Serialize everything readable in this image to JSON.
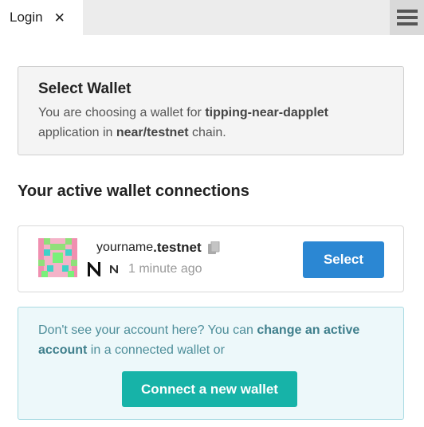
{
  "tab": {
    "label": "Login",
    "close_glyph": "✕"
  },
  "info_box": {
    "title": "Select Wallet",
    "line1_prefix": "You are choosing a wallet for ",
    "app_name": "tipping-near-dapplet",
    "line2_prefix": "application in ",
    "chain": "near/testnet",
    "line2_suffix": " chain."
  },
  "section_title": "Your active wallet connections",
  "wallet": {
    "account_name": "yourname",
    "account_suffix": ".testnet",
    "time_ago": "1 minute ago",
    "select_label": "Select",
    "icons": [
      "avatar-identicon",
      "copy-icon",
      "near-wallet-icon",
      "near-network-icon"
    ]
  },
  "connect_box": {
    "text_prefix": "Don't see your account here? You can ",
    "link_text": "change an active account",
    "text_suffix": " in a connected wallet or",
    "button_label": "Connect a new wallet"
  },
  "colors": {
    "select_button": "#2b87d3",
    "connect_button": "#17b3a8",
    "connect_box_bg": "#edf8fa",
    "connect_text": "#4e8e9a"
  }
}
